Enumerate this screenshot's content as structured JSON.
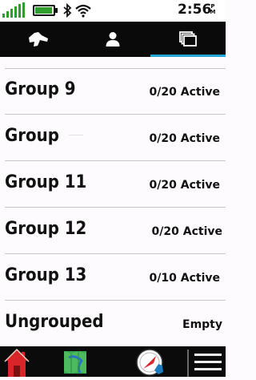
{
  "status_bar": {
    "time": "2:56",
    "ampm_top": "P",
    "ampm_bottom": "M",
    "battery_level": 0.95,
    "signal_bars": 5
  },
  "tabs": [
    {
      "icon": "hound-dog-icon",
      "active": false
    },
    {
      "icon": "person-icon",
      "active": false
    },
    {
      "icon": "stacked-windows-icon",
      "active": true
    }
  ],
  "groups": [
    {
      "name": "Group 9",
      "status": "0/20 Active"
    },
    {
      "name": "Group",
      "status": "0/20 Active"
    },
    {
      "name": "Group 11",
      "status": "0/20 Active"
    },
    {
      "name": "Group 12",
      "status": "0/20 Active"
    },
    {
      "name": "Group 13",
      "status": "0/10 Active"
    },
    {
      "name": "Ungrouped",
      "status": "Empty"
    }
  ],
  "bottom_nav": [
    {
      "icon": "home-icon"
    },
    {
      "icon": "map-icon"
    },
    {
      "icon": "compass-dog-icon"
    },
    {
      "icon": "menu-icon"
    }
  ],
  "colors": {
    "accent": "#22a7d6",
    "signal_green": "#2f9e2f",
    "home_red": "#d8252a"
  }
}
